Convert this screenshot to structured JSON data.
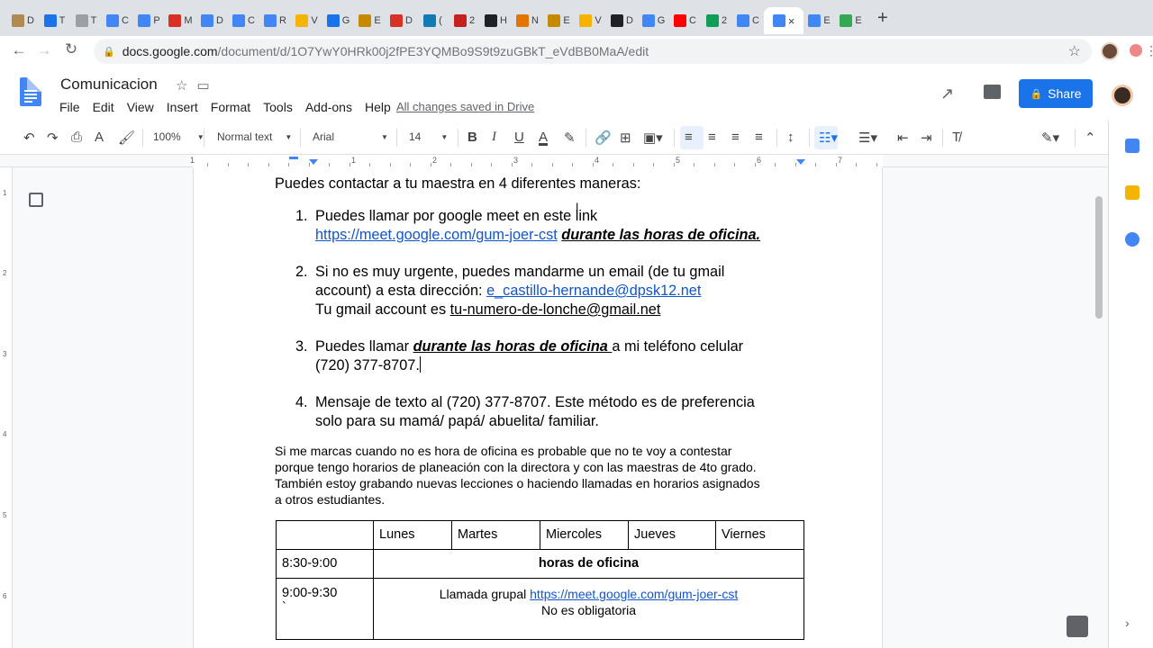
{
  "browser": {
    "tabs": [
      {
        "label": "D",
        "color": "#b08a50"
      },
      {
        "label": "T",
        "color": "#1a73e8"
      },
      {
        "label": "T",
        "color": "#9aa0a6"
      },
      {
        "label": "C",
        "color": "#4285f4"
      },
      {
        "label": "P",
        "color": "#4285f4"
      },
      {
        "label": "M",
        "color": "#d93025"
      },
      {
        "label": "D",
        "color": "#4285f4"
      },
      {
        "label": "C",
        "color": "#4285f4"
      },
      {
        "label": "R",
        "color": "#4285f4"
      },
      {
        "label": "V",
        "color": "#f4b400"
      },
      {
        "label": "G",
        "color": "#1a73e8"
      },
      {
        "label": "E",
        "color": "#c58a00"
      },
      {
        "label": "D",
        "color": "#d93025"
      },
      {
        "label": "(",
        "color": "#137ab4"
      },
      {
        "label": "2",
        "color": "#c5221f"
      },
      {
        "label": "H",
        "color": "#202124"
      },
      {
        "label": "N",
        "color": "#e37400"
      },
      {
        "label": "E",
        "color": "#c58a00"
      },
      {
        "label": "V",
        "color": "#f4b400"
      },
      {
        "label": "D",
        "color": "#202124"
      },
      {
        "label": "G",
        "color": "#4285f4"
      },
      {
        "label": "C",
        "color": "#ff0000"
      },
      {
        "label": "2",
        "color": "#0f9d58"
      },
      {
        "label": "C",
        "color": "#4285f4"
      }
    ],
    "active_tab": {
      "label": "×",
      "color": "#4285f4"
    },
    "after_tabs": [
      {
        "label": "E",
        "color": "#4285f4"
      },
      {
        "label": "E",
        "color": "#34a853"
      }
    ],
    "new_tab": "+",
    "url_host": "docs.google.com",
    "url_path": "/document/d/1O7YwY0HRk00j2fPE3YQMBo9S9t9zuGBkT_eVdBB0MaA/edit"
  },
  "docs": {
    "title": "Comunicacion",
    "menu": [
      "File",
      "Edit",
      "View",
      "Insert",
      "Format",
      "Tools",
      "Add-ons",
      "Help"
    ],
    "saved_status": "All changes saved in Drive",
    "share_label": "Share",
    "toolbar": {
      "zoom": "100%",
      "style": "Normal text",
      "font": "Arial",
      "size": "14"
    }
  },
  "document": {
    "intro": "Puedes contactar a tu maestra en 4 diferentes maneras:",
    "item1": {
      "num": "1.",
      "line1": "Puedes llamar por google meet en este link",
      "link": "https://meet.google.com/gum-joer-cst",
      "bold": "durante las horas de oficina."
    },
    "item2": {
      "num": "2.",
      "line1": "Si no es muy urgente, puedes mandarme un email (de tu gmail",
      "line2_pre": "account) a esta dirección: ",
      "email_link": "e_castillo-hernande@dpsk12.net",
      "line3_pre": "Tu gmail account es ",
      "line3_ul": "tu-numero-de-lonche@gmail.net"
    },
    "item3": {
      "num": "3.",
      "pre": "Puedes llamar ",
      "bold": "durante las horas de oficina ",
      "post": "a mi teléfono celular",
      "line2": "(720) 377-8707."
    },
    "item4": {
      "num": "4.",
      "line1": "Mensaje de texto al (720) 377-8707. Este método es de preferencia",
      "line2": "solo para su mamá/ papá/ abuelita/ familiar."
    },
    "note": [
      "Si me marcas cuando no es hora de oficina es probable que no te voy a contestar",
      "porque tengo horarios de planeación con la directora y con las maestras de 4to grado.",
      "También estoy grabando nuevas lecciones o haciendo llamadas en horarios asignados",
      "a otros estudiantes."
    ],
    "table": {
      "headers": [
        "",
        "Lunes",
        "Martes",
        "Miercoles",
        "Jueves",
        "Viernes"
      ],
      "row1": {
        "time": "8:30-9:00",
        "content": "horas de oficina"
      },
      "row2": {
        "time": "9:00-9:30",
        "extra": "`",
        "pre": "Llamada grupal ",
        "link": "https://meet.google.com/gum-joer-cst",
        "line2": "No es obligatoria"
      }
    }
  },
  "ruler": {
    "numbers": [
      "1",
      "1",
      "2",
      "3",
      "4",
      "5",
      "6",
      "7"
    ],
    "vnumbers": [
      "1",
      "2",
      "3",
      "4",
      "5",
      "6"
    ]
  }
}
